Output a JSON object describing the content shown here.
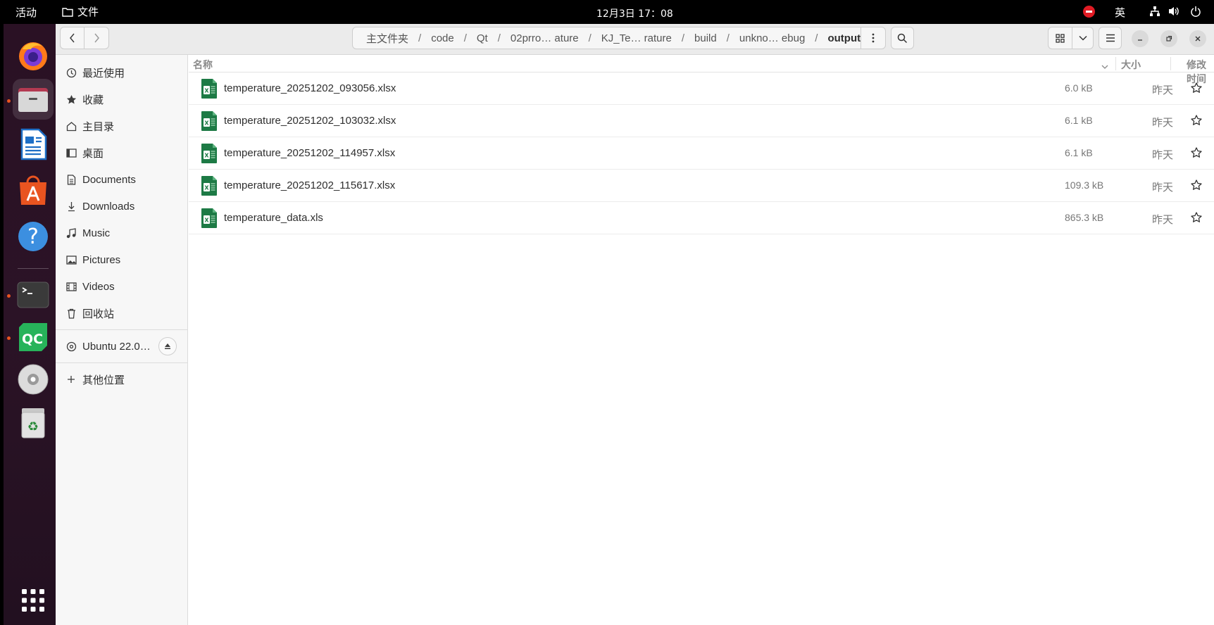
{
  "topbar": {
    "activities": "活动",
    "app_name": "文件",
    "clock": "12月3日 17：08",
    "lang": "英"
  },
  "dock": {
    "items": [
      "firefox",
      "files",
      "libreoffice-writer",
      "app-center",
      "help",
      "terminal",
      "qt-creator",
      "dvd-drive",
      "trash"
    ]
  },
  "pathbar": {
    "crumbs": [
      "主文件夹",
      "code",
      "Qt",
      "02prro… ature",
      "KJ_Te… rature",
      "build",
      "unkno… ebug",
      "output"
    ]
  },
  "sidebar": {
    "items": [
      {
        "label": "最近使用",
        "icon": "clock-icon"
      },
      {
        "label": "收藏",
        "icon": "star-icon"
      },
      {
        "label": "主目录",
        "icon": "home-icon"
      },
      {
        "label": "桌面",
        "icon": "desktop-icon"
      },
      {
        "label": "Documents",
        "icon": "document-icon"
      },
      {
        "label": "Downloads",
        "icon": "download-icon"
      },
      {
        "label": "Music",
        "icon": "music-icon"
      },
      {
        "label": "Pictures",
        "icon": "picture-icon"
      },
      {
        "label": "Videos",
        "icon": "video-icon"
      },
      {
        "label": "回收站",
        "icon": "trash-icon"
      }
    ],
    "drive": "Ubuntu 22.0…",
    "other_locations": "其他位置"
  },
  "columns": {
    "name": "名称",
    "size": "大小",
    "modified": "修改时间"
  },
  "files": [
    {
      "name": "temperature_20251202_093056.xlsx",
      "size": "6.0 kB",
      "modified": "昨天"
    },
    {
      "name": "temperature_20251202_103032.xlsx",
      "size": "6.1 kB",
      "modified": "昨天"
    },
    {
      "name": "temperature_20251202_114957.xlsx",
      "size": "6.1 kB",
      "modified": "昨天"
    },
    {
      "name": "temperature_20251202_115617.xlsx",
      "size": "109.3 kB",
      "modified": "昨天"
    },
    {
      "name": "temperature_data.xls",
      "size": "865.3 kB",
      "modified": "昨天"
    }
  ],
  "colors": {
    "accent": "#e95420",
    "sheet_green": "#1d7a45",
    "dock_bg": "#2b1326"
  }
}
